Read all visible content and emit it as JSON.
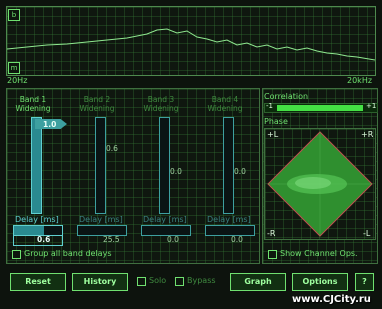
{
  "spectrum": {
    "top_marker": "b",
    "bottom_marker": "m",
    "freq_start": "20Hz",
    "freq_end": "20kHz"
  },
  "bands": [
    {
      "title": "Band 1",
      "subtitle": "Widening",
      "value": "1.0",
      "level": 1.0,
      "delay_value": "0.6",
      "active": true
    },
    {
      "title": "Band 2",
      "subtitle": "Widening",
      "value": "0.6",
      "level": 0.6,
      "delay_value": "25.5",
      "active": false
    },
    {
      "title": "Band 3",
      "subtitle": "Widening",
      "value": "0.0",
      "level": 0.0,
      "delay_value": "0.0",
      "active": false
    },
    {
      "title": "Band 4",
      "subtitle": "Widening",
      "value": "0.0",
      "level": 0.0,
      "delay_value": "0.0",
      "active": false
    }
  ],
  "delay_label": "Delay [ms]",
  "group_all_label": "Group all band delays",
  "correlation": {
    "label": "Correlation",
    "min": "-1",
    "max": "+1",
    "value": 1.0
  },
  "phase": {
    "label": "Phase",
    "tl": "+L",
    "tr": "+R",
    "bl": "-R",
    "br": "-L"
  },
  "show_channel_ops_label": "Show Channel Ops.",
  "footer": {
    "reset": "Reset",
    "history": "History",
    "solo": "Solo",
    "bypass": "Bypass",
    "graph": "Graph",
    "options": "Options",
    "help": "?"
  },
  "watermark": "www.CJCity.ru",
  "colors": {
    "accent": "#6fe06f",
    "teal": "#3da0a0",
    "bg": "#0d130d"
  }
}
